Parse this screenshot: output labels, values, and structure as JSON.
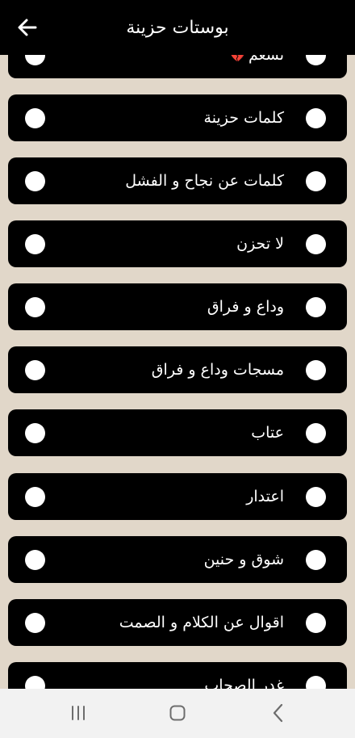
{
  "header": {
    "title": "بوستات حزينة",
    "back_icon": "arrow-back-icon"
  },
  "list": {
    "items": [
      {
        "label": "نسعم",
        "icon": "broken-heart-icon",
        "heart_glyph": "💔"
      },
      {
        "label": "كلمات حزينة"
      },
      {
        "label": "كلمات عن نجاح و الفشل"
      },
      {
        "label": "لا تحزن"
      },
      {
        "label": "وداع و فراق"
      },
      {
        "label": "مسجات وداع و فراق"
      },
      {
        "label": "عتاب"
      },
      {
        "label": "اعتدار"
      },
      {
        "label": "شوق و حنين"
      },
      {
        "label": "اقوال عن الكلام و الصمت"
      },
      {
        "label": "غدر الصحاب"
      }
    ]
  },
  "navbar": {
    "recents_icon": "recents-icon",
    "home_icon": "home-icon",
    "back_icon": "nav-back-icon"
  },
  "colors": {
    "background": "#e1d7c9",
    "card": "#000000",
    "text": "#ffffff",
    "heart": "#e0405f"
  }
}
